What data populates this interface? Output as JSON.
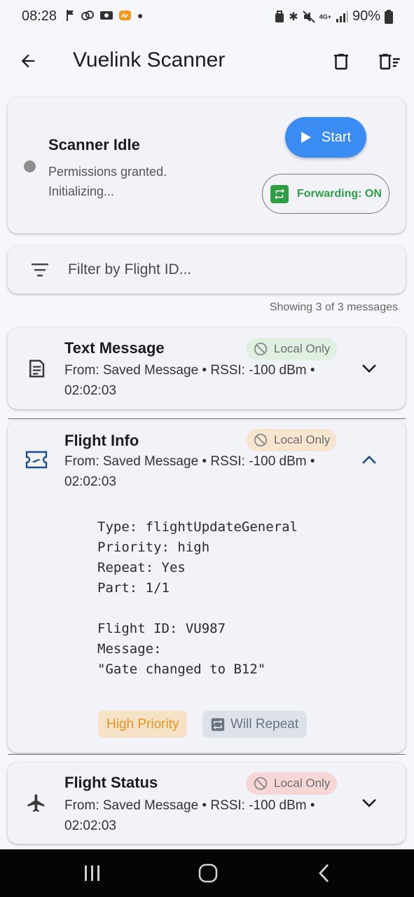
{
  "status_bar": {
    "time": "08:28",
    "network": "4G+",
    "battery": "90%"
  },
  "app_bar": {
    "title": "Vuelink Scanner"
  },
  "scanner": {
    "status_title": "Scanner Idle",
    "status_sub": "Permissions granted. Initializing...",
    "start_label": "Start",
    "forwarding_label": "Forwarding: ON",
    "colors": {
      "start": "#3b8cf2",
      "forwarding": "#2e9e45",
      "idle_dot": "#8e8e8e"
    }
  },
  "filter": {
    "placeholder": "Filter by Flight ID...",
    "count_text": "Showing 3 of 3 messages"
  },
  "messages": [
    {
      "title": "Text Message",
      "icon": "document-icon",
      "badge": "Local Only",
      "badge_color": "#dff0e0",
      "subtitle": "From: Saved Message • RSSI: -100 dBm • 02:02:03",
      "expanded": false
    },
    {
      "title": "Flight Info",
      "icon": "ticket-icon",
      "badge": "Local Only",
      "badge_color": "#f7e6cf",
      "subtitle": "From: Saved Message • RSSI: -100 dBm • 02:02:03",
      "expanded": true,
      "details": "Type: flightUpdateGeneral\nPriority: high\nRepeat: Yes\nPart: 1/1\n\nFlight ID: VU987\nMessage:\n\"Gate changed to B12\"",
      "tags": [
        "High Priority",
        "Will Repeat"
      ]
    },
    {
      "title": "Flight Status",
      "icon": "airplane-icon",
      "badge": "Local Only",
      "badge_color": "#f6d6d6",
      "subtitle": "From: Saved Message • RSSI: -100 dBm • 02:02:03",
      "expanded": false
    }
  ]
}
